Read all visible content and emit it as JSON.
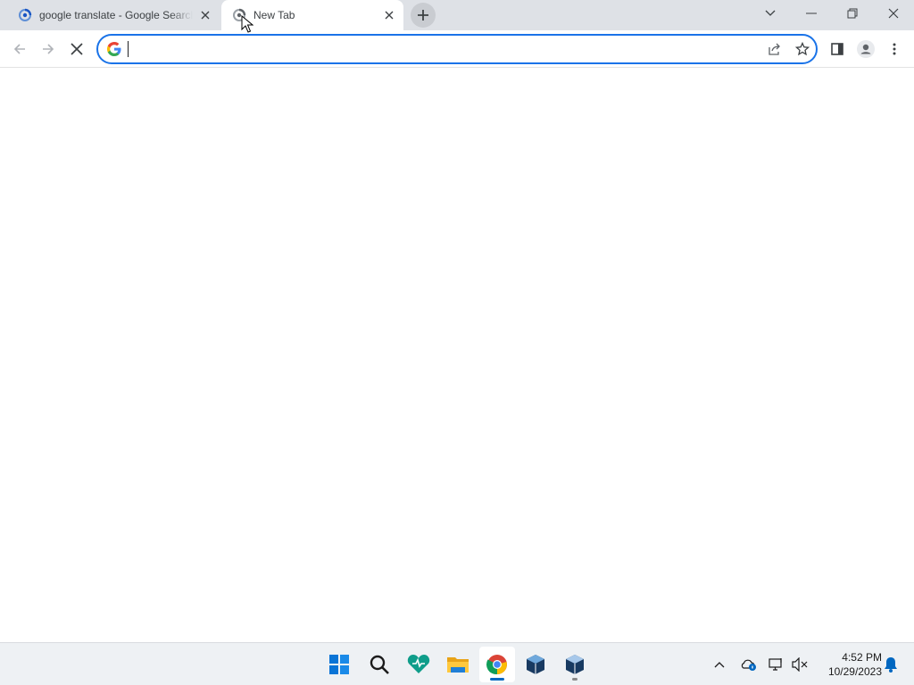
{
  "browser": {
    "tabs": [
      {
        "title": "google translate - Google Search",
        "icon": "loading-spinner-icon",
        "active": false
      },
      {
        "title": "New Tab",
        "icon": "loading-spinner-icon",
        "active": true
      }
    ],
    "omnibox": {
      "value": "",
      "placeholder": ""
    }
  },
  "taskbar": {
    "apps": [
      "windows-start-icon",
      "search-icon",
      "app-heart-icon",
      "file-explorer-icon",
      "chrome-icon",
      "virtualbox-icon",
      "virtualbox-vm-icon"
    ],
    "clock": {
      "time": "4:52 PM",
      "date": "10/29/2023"
    }
  },
  "colors": {
    "accent": "#1a73e8",
    "tabstrip": "#dee1e6"
  }
}
